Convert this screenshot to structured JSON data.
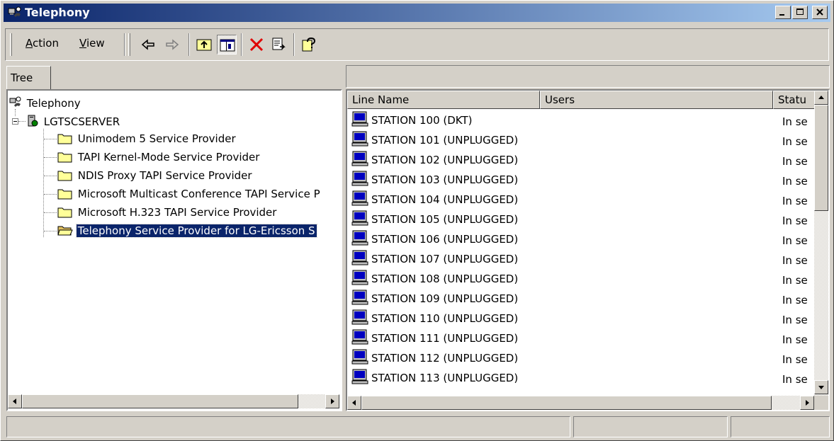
{
  "window": {
    "title": "Telephony"
  },
  "menu": {
    "action": "Action",
    "action_key": "A",
    "view": "View",
    "view_key": "V"
  },
  "tabs": {
    "tree": "Tree"
  },
  "tree": {
    "root": "Telephony",
    "server": "LGTSCSERVER",
    "providers": [
      "Unimodem 5 Service Provider",
      "TAPI Kernel-Mode Service Provider",
      "NDIS Proxy TAPI Service Provider",
      "Microsoft Multicast Conference TAPI Service P",
      "Microsoft H.323 TAPI Service Provider",
      "Telephony Service Provider for LG-Ericsson S"
    ],
    "selected_index": 5
  },
  "list": {
    "columns": [
      "Line Name",
      "Users",
      "Statu"
    ],
    "rows": [
      {
        "name": "STATION  100 (DKT)",
        "status": "In se"
      },
      {
        "name": "STATION  101 (UNPLUGGED)",
        "status": "In se"
      },
      {
        "name": "STATION  102 (UNPLUGGED)",
        "status": "In se"
      },
      {
        "name": "STATION  103 (UNPLUGGED)",
        "status": "In se"
      },
      {
        "name": "STATION  104 (UNPLUGGED)",
        "status": "In se"
      },
      {
        "name": "STATION  105 (UNPLUGGED)",
        "status": "In se"
      },
      {
        "name": "STATION  106 (UNPLUGGED)",
        "status": "In se"
      },
      {
        "name": "STATION  107 (UNPLUGGED)",
        "status": "In se"
      },
      {
        "name": "STATION  108 (UNPLUGGED)",
        "status": "In se"
      },
      {
        "name": "STATION  109 (UNPLUGGED)",
        "status": "In se"
      },
      {
        "name": "STATION  110 (UNPLUGGED)",
        "status": "In se"
      },
      {
        "name": "STATION  111 (UNPLUGGED)",
        "status": "In se"
      },
      {
        "name": "STATION  112 (UNPLUGGED)",
        "status": "In se"
      },
      {
        "name": "STATION  113 (UNPLUGGED)",
        "status": "In se"
      }
    ]
  },
  "icons": {
    "title": "telephony-icon",
    "toolbar": [
      "back-arrow-icon",
      "forward-arrow-icon",
      "up-folder-icon",
      "show-hide-tree-icon",
      "delete-icon",
      "export-list-icon",
      "help-icon"
    ],
    "row": "computer-line-icon"
  },
  "colors": {
    "titlebar_start": "#0a246a",
    "titlebar_end": "#a6caf0",
    "selection": "#0a246a",
    "face": "#d4d0c8"
  }
}
